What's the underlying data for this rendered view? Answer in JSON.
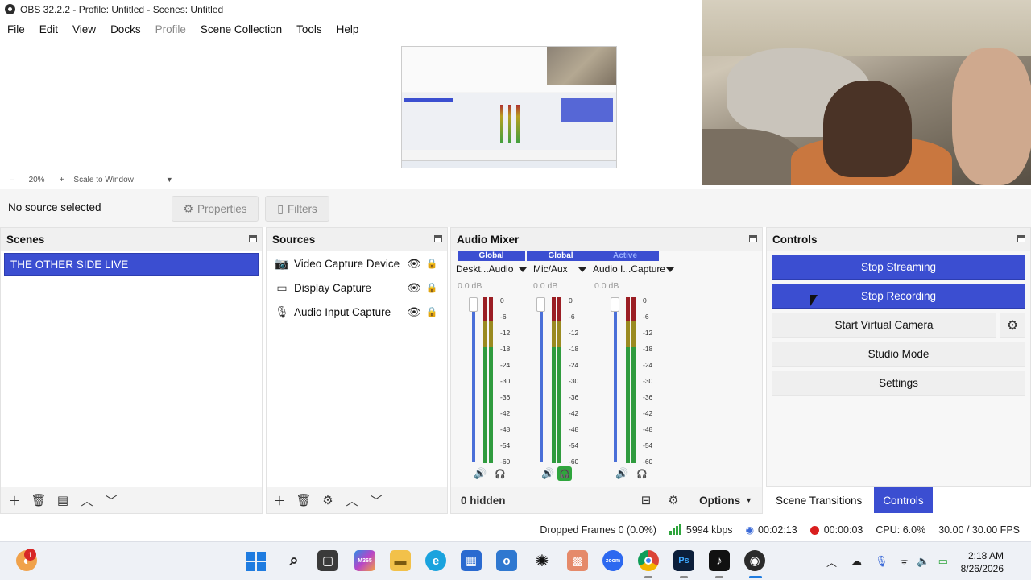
{
  "window": {
    "title": "OBS 32.2.2 - Profile: Untitled - Scenes: Untitled"
  },
  "menu": [
    "File",
    "Edit",
    "View",
    "Docks",
    "Profile",
    "Scene Collection",
    "Tools",
    "Help"
  ],
  "preview": {
    "zoom_minus": "–",
    "zoom_level": "20%",
    "zoom_plus": "+",
    "scale_mode": "Scale to Window"
  },
  "source_toolbar": {
    "status": "No source selected",
    "properties_label": "Properties",
    "filters_label": "Filters"
  },
  "scenes": {
    "title": "Scenes",
    "items": [
      "THE OTHER SIDE LIVE"
    ]
  },
  "sources": {
    "title": "Sources",
    "items": [
      {
        "label": "Video Capture Device",
        "icon": "camera-icon"
      },
      {
        "label": "Display Capture",
        "icon": "monitor-icon"
      },
      {
        "label": "Audio Input Capture",
        "icon": "microphone-icon"
      }
    ]
  },
  "mixer": {
    "title": "Audio Mixer",
    "channels": [
      {
        "badge": "Global",
        "name": "Deskt...Audio",
        "db": "0.0 dB",
        "monitor_on": false
      },
      {
        "badge": "Global",
        "name": "Mic/Aux",
        "db": "0.0 dB",
        "monitor_on": true
      },
      {
        "badge": "Active",
        "name": "Audio I...Capture",
        "db": "0.0 dB",
        "monitor_on": false
      }
    ],
    "ticks": [
      "0",
      "-6",
      "-12",
      "-18",
      "-24",
      "-30",
      "-36",
      "-42",
      "-48",
      "-54",
      "-60"
    ],
    "hidden_label": "0 hidden",
    "options_label": "Options"
  },
  "controls": {
    "title": "Controls",
    "stop_streaming": "Stop Streaming",
    "stop_recording": "Stop Recording",
    "start_virtual_camera": "Start Virtual Camera",
    "studio_mode": "Studio Mode",
    "settings": "Settings",
    "tab_scene_transitions": "Scene Transitions",
    "tab_controls": "Controls"
  },
  "status": {
    "dropped_frames": "Dropped Frames 0 (0.0%)",
    "bitrate": "5994 kbps",
    "stream_time": "00:02:13",
    "record_time": "00:00:03",
    "cpu": "CPU: 6.0%",
    "fps": "30.00 / 30.00 FPS"
  },
  "taskbar": {
    "notification_count": "1",
    "app_badge_m365": "M365",
    "app_badge_zoom": "zoom",
    "app_badge_ps": "Ps",
    "time": "2:18 AM",
    "date": "8/26/2026"
  },
  "colors": {
    "accent": "#3b4ed1",
    "record_red": "#d91e1e",
    "meter_green": "#2fa53d"
  }
}
